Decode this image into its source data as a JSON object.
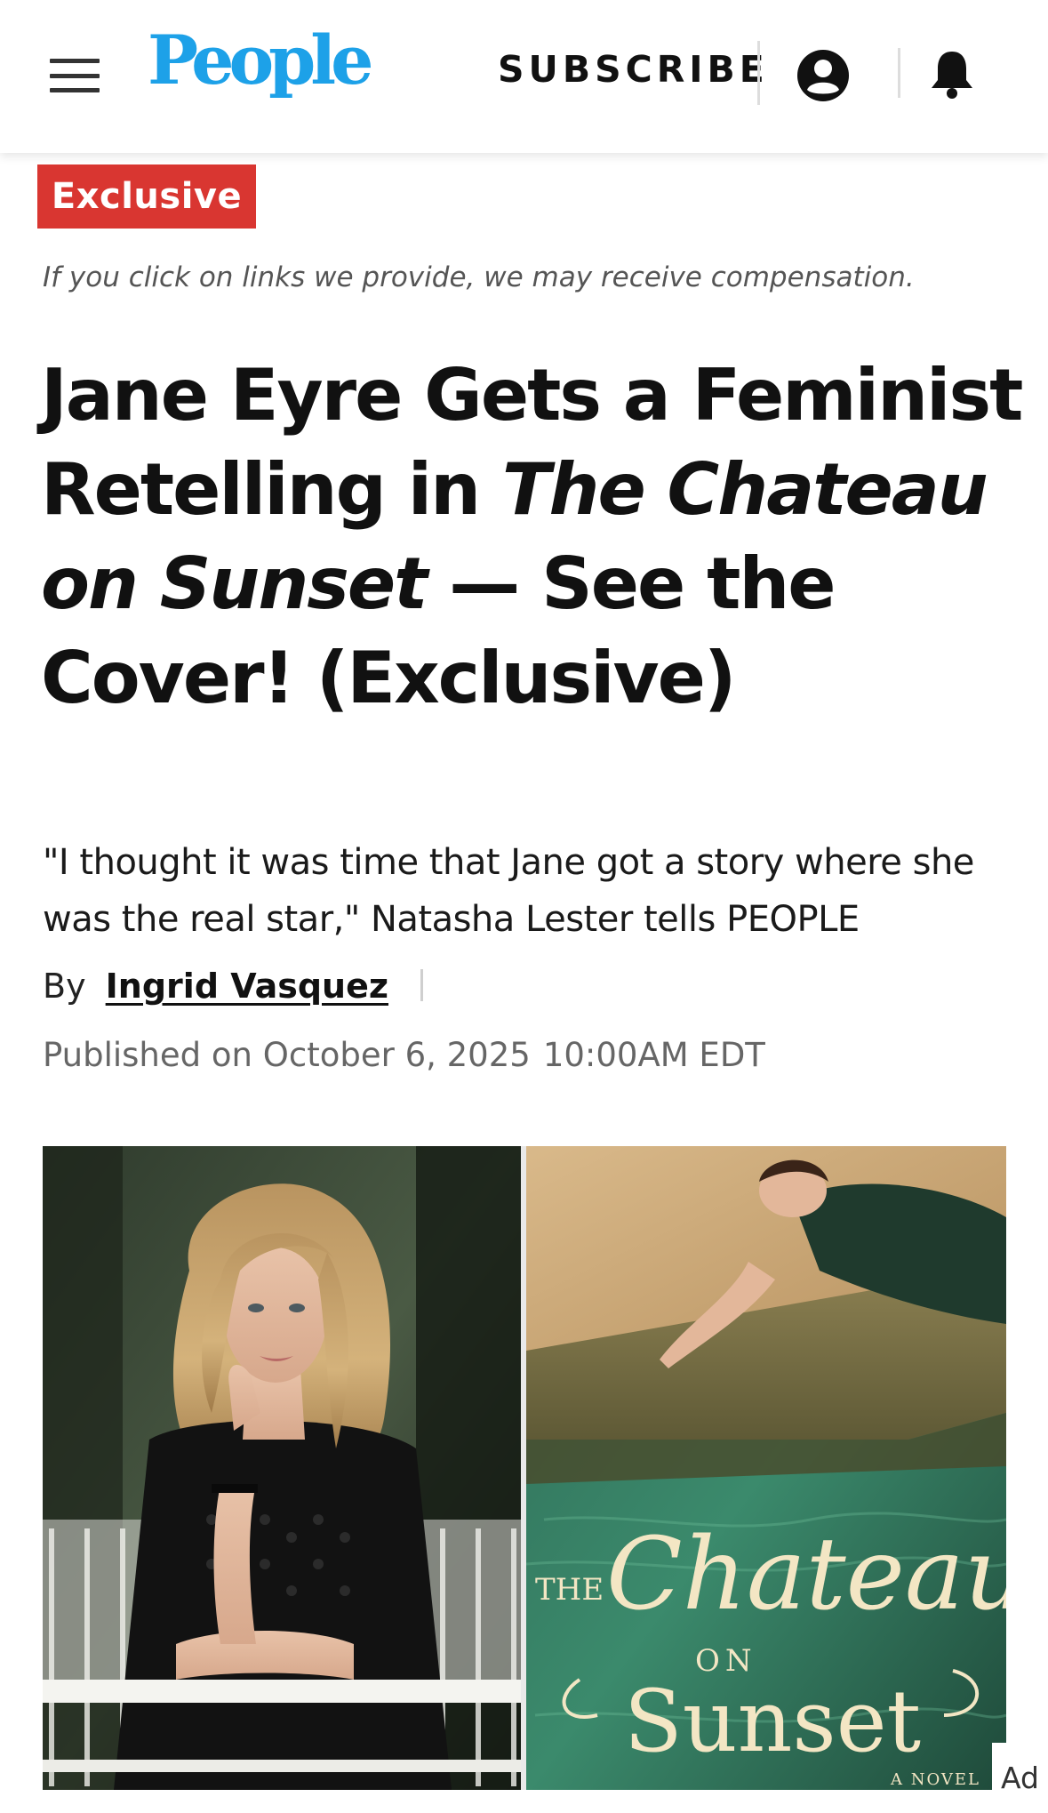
{
  "header": {
    "logo_text": "People",
    "subscribe_label": "SUBSCRIBE",
    "menu_icon": "hamburger-menu-icon",
    "account_icon": "account-circle-icon",
    "bell_icon": "notification-bell-icon",
    "brand_color": "#1da1e8"
  },
  "article": {
    "badge": "Exclusive",
    "badge_color": "#d93631",
    "disclaimer": "If you click on links we provide, we may receive compensation.",
    "headline_part1": "Jane Eyre Gets a Feminist Retelling in ",
    "headline_italic": "The Chateau on Sunset",
    "headline_part2": " — See the Cover! (Exclusive)",
    "dek": "\"I thought it was time that Jane got a story where she was the real star,\" Natasha Lester tells PEOPLE",
    "by_label": "By",
    "author": "Ingrid Vasquez",
    "published_label": "Published on October 6, 2025",
    "published_time": "10:00AM EDT"
  },
  "hero": {
    "cover_title_the": "THE",
    "cover_title_chateau": "Chateau",
    "cover_title_on": "ON",
    "cover_title_sunset": "Sunset",
    "cover_subtitle": "A NOVEL"
  },
  "ad": {
    "label": "Ad"
  }
}
